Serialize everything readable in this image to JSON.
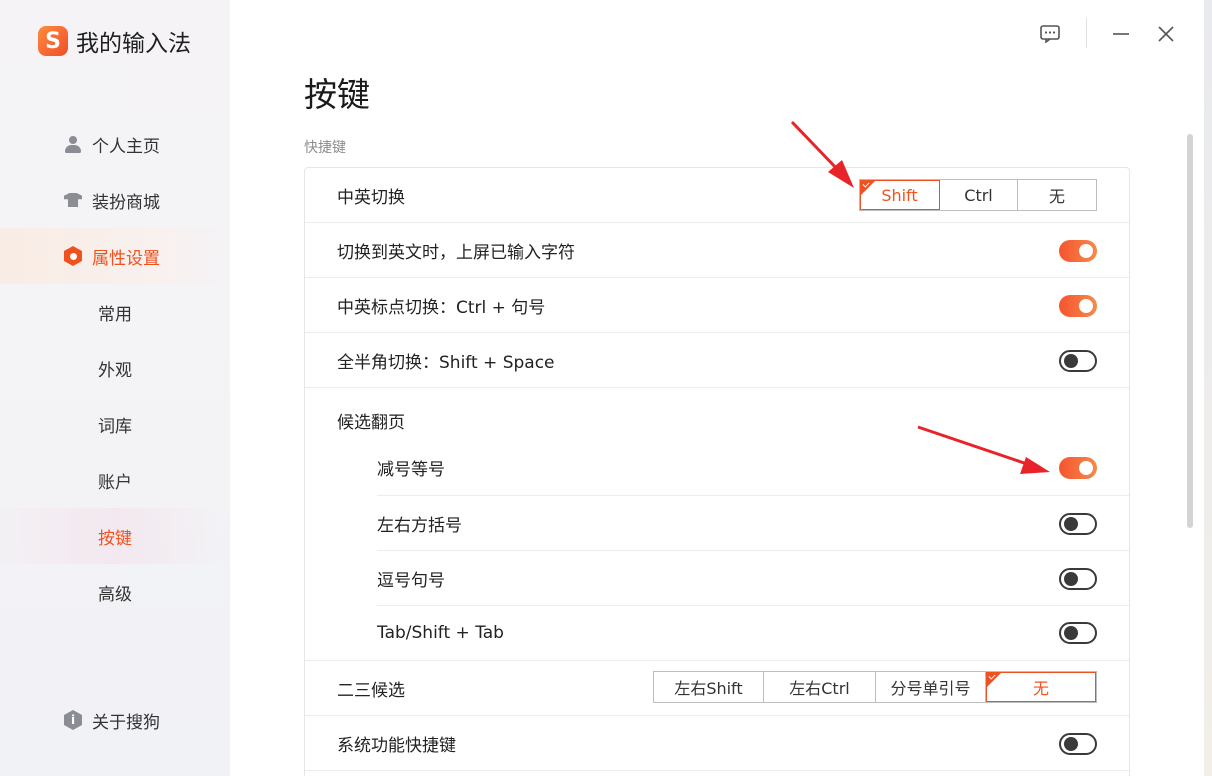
{
  "app": {
    "brand_logo_letter": "S",
    "brand_name": "我的输入法"
  },
  "titlebar": {
    "feedback_icon": "feedback-icon",
    "minimize_icon": "minimize-icon",
    "close_icon": "close-icon"
  },
  "sidebar": {
    "main_items": [
      {
        "label": "个人主页",
        "icon": "person-icon"
      },
      {
        "label": "装扮商城",
        "icon": "shirt-icon"
      },
      {
        "label": "属性设置",
        "icon": "settings-hex-icon",
        "active": true
      }
    ],
    "sub_items": [
      {
        "label": "常用"
      },
      {
        "label": "外观"
      },
      {
        "label": "词库"
      },
      {
        "label": "账户"
      },
      {
        "label": "按键",
        "active": true
      },
      {
        "label": "高级"
      }
    ],
    "footer": {
      "label": "关于搜狗",
      "icon": "info-icon",
      "icon_glyph": "i"
    }
  },
  "main": {
    "title": "按键",
    "section_label": "快捷键",
    "rows": {
      "cn_en_switch": {
        "label": "中英切换",
        "options": [
          "Shift",
          "Ctrl",
          "无"
        ],
        "selected": "Shift"
      },
      "commit_on_switch": {
        "label": "切换到英文时，上屏已输入字符",
        "on": true
      },
      "punct_switch": {
        "label": "中英标点切换：Ctrl + 句号",
        "on": true
      },
      "width_switch": {
        "label": "全半角切换：Shift + Space",
        "on": false
      },
      "page_turn": {
        "label": "候选翻页",
        "items": [
          {
            "label": "减号等号",
            "on": true
          },
          {
            "label": "左右方括号",
            "on": false
          },
          {
            "label": "逗号句号",
            "on": false
          },
          {
            "label": "Tab/Shift + Tab",
            "on": false
          }
        ]
      },
      "second_third": {
        "label": "二三候选",
        "options": [
          "左右Shift",
          "左右Ctrl",
          "分号单引号",
          "无"
        ],
        "selected": "无"
      },
      "system_shortcuts": {
        "label": "系统功能快捷键",
        "on": false
      }
    }
  },
  "colors": {
    "accent": "#f0521f",
    "toggle_on_start": "#f6542f",
    "toggle_on_end": "#f58a4c",
    "annotation_arrow": "#e8242a"
  }
}
